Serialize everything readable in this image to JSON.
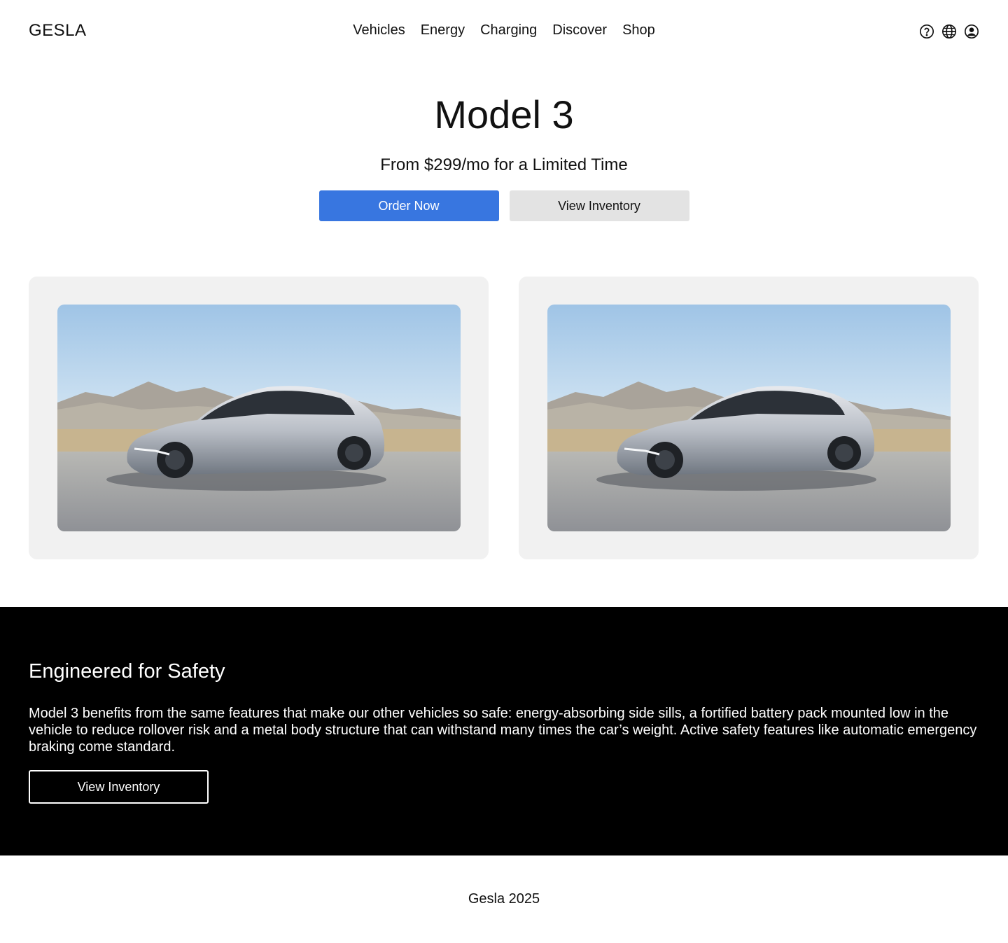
{
  "header": {
    "logo": "GESLA",
    "nav": [
      "Vehicles",
      "Energy",
      "Charging",
      "Discover",
      "Shop"
    ],
    "icons": [
      "help-icon",
      "globe-icon",
      "account-icon"
    ]
  },
  "hero": {
    "title": "Model 3",
    "subtitle": "From $299/mo for a Limited Time",
    "primary_button": "Order Now",
    "secondary_button": "View Inventory",
    "accent_color": "#3876e0"
  },
  "gallery": {
    "images": [
      "car-photo",
      "car-photo"
    ]
  },
  "safety": {
    "title": "Engineered for Safety",
    "text": "Model 3 benefits from the same features that make our other vehicles so safe: energy-absorbing side sills, a fortified battery pack mounted low in the vehicle to reduce rollover risk and a metal body structure that can withstand many times the car’s weight. Active safety features like automatic emergency braking come standard.",
    "button": "View Inventory"
  },
  "footer": {
    "text": "Gesla 2025"
  }
}
